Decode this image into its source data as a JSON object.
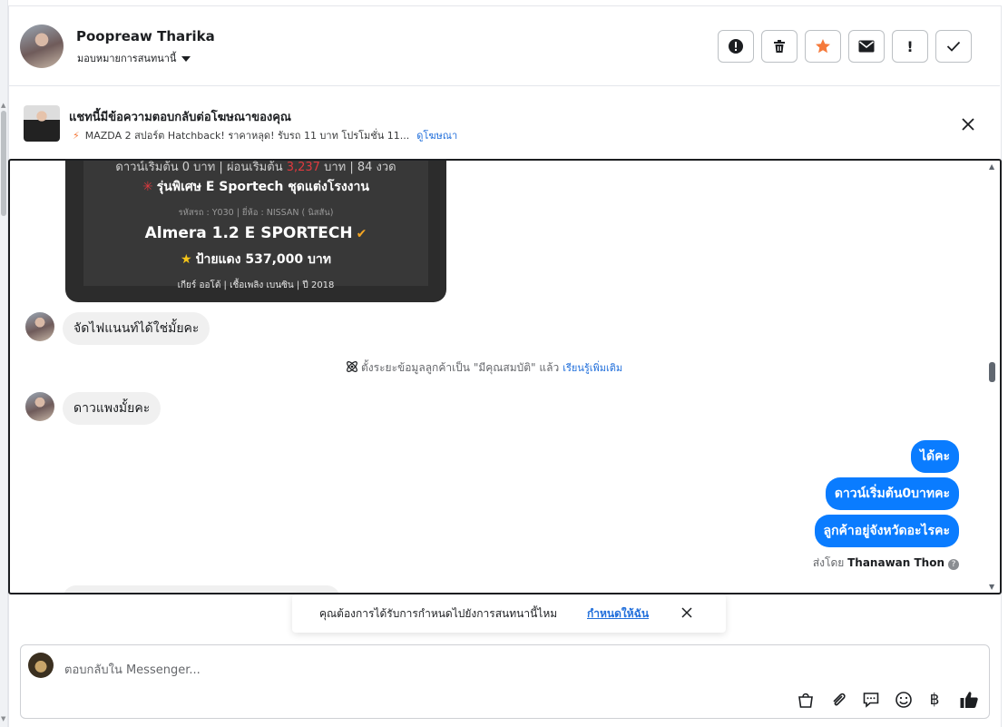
{
  "header": {
    "contact_name": "Poopreaw Tharika",
    "assign_label": "มอบหมายการสนทนานี้",
    "actions": [
      {
        "name": "report-icon",
        "label": "!"
      },
      {
        "name": "trash-icon",
        "label": ""
      },
      {
        "name": "star-icon",
        "label": ""
      },
      {
        "name": "envelope-icon",
        "label": ""
      },
      {
        "name": "exclamation-icon",
        "label": "!"
      },
      {
        "name": "checkmark-icon",
        "label": ""
      }
    ],
    "star_color": "#f5793a"
  },
  "ad_banner": {
    "title": "แชทนี้มีข้อความตอบกลับต่อโฆษณาของคุณ",
    "subtitle": "MAZDA 2 สปอร์ต Hatchback! ราคาหลุด! รับรถ 11 บาท โปรโมชั่น 11...",
    "link": "ดูโฆษณา"
  },
  "car_image": {
    "line1_prefix": "ดาวน์เริ่มต้น 0 บาท | ผ่อนเริ่มต้น ",
    "line1_price": "3,237",
    "line1_suffix": " บาท | 84 งวด",
    "line2": "รุ่นพิเศษ E Sportech ชุดแต่งโรงงาน",
    "line3": "รหัสรถ : Y030 | ยี่ห้อ : NISSAN ( นิสสัน)",
    "line4": "Almera 1.2 E SPORTECH",
    "line5": "ป้ายแดง 537,000 บาท",
    "line6": "เกียร์ ออโต้   |   เชื้อเพลิง เบนซิน   |   ปี 2018"
  },
  "messages": {
    "incoming_1": "จัดไฟแนนท์ได้ใช่มั้ยคะ",
    "incoming_2": "ดาวแพงมั้ยคะ",
    "outgoing": [
      "ได้คะ",
      "ดาวน์เริ่มต้น0บาทคะ",
      "ลูกค้าอยู่จังหวัดอะไรคะ"
    ]
  },
  "system_note": {
    "text": "ตั้งระยะข้อมูลลูกค้าเป็น \"มีคุณสมบัติ\" แล้ว",
    "link": "เรียนรู้เพิ่มเติม"
  },
  "sent_by": {
    "prefix": "ส่งโดย",
    "agent": "Thanawan Thon",
    "help": "?"
  },
  "assign_prompt": {
    "question": "คุณต้องการได้รับการกำหนดไปยังการสนทนานี้ไหม",
    "action": "กำหนดให้ฉัน"
  },
  "composer": {
    "placeholder": "ตอบกลับใน Messenger...",
    "baht_symbol": "฿",
    "tools": [
      "shopping-bag-icon",
      "paperclip-icon",
      "saved-reply-icon",
      "emoji-icon",
      "baht-icon",
      "thumbs-up-icon"
    ],
    "like_color": "#1c1e21"
  },
  "colors": {
    "outgoing_bubble": "#0a7cff",
    "incoming_bubble": "#f0f0f0",
    "link": "#216fdb"
  }
}
